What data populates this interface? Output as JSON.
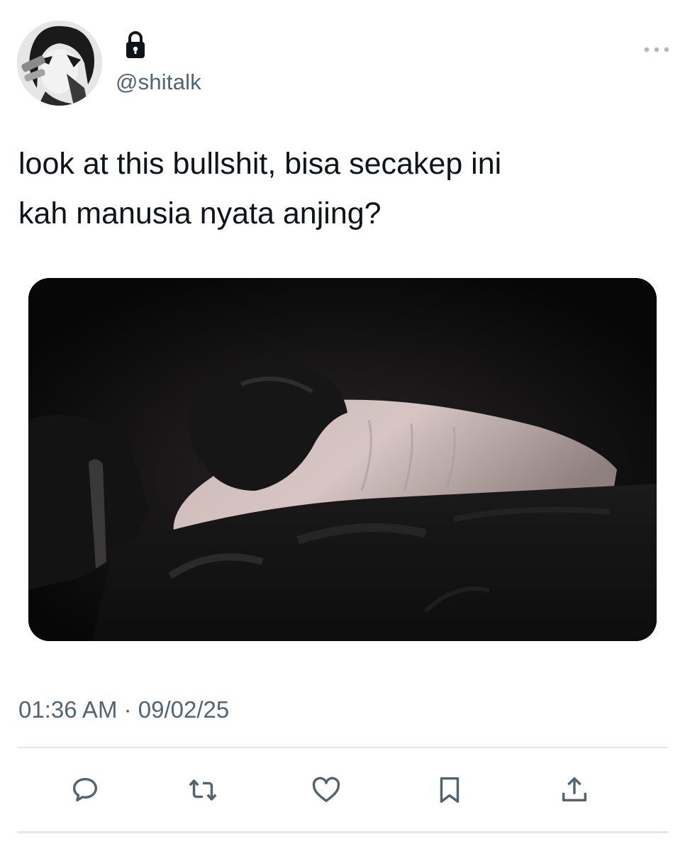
{
  "account": {
    "handle": "@shitalk",
    "avatar_icon": "avatar-image",
    "protected_icon": "lock-icon"
  },
  "menu": {
    "more_icon": "more-icon"
  },
  "tweet": {
    "text": "look at this bullshit, bisa secakep ini\nkah manusia nyata anjing?",
    "media_description": "photo-thumbnail",
    "timestamp": "01:36 AM · 09/02/25"
  },
  "actions": [
    {
      "name": "reply",
      "icon": "comment-icon"
    },
    {
      "name": "retweet",
      "icon": "retweet-icon"
    },
    {
      "name": "like",
      "icon": "heart-icon"
    },
    {
      "name": "bookmark",
      "icon": "bookmark-icon"
    },
    {
      "name": "share",
      "icon": "share-icon"
    }
  ],
  "colors": {
    "text": "#0f1419",
    "secondary": "#536471",
    "divider": "#e1e8ed",
    "icon": "#536471"
  }
}
